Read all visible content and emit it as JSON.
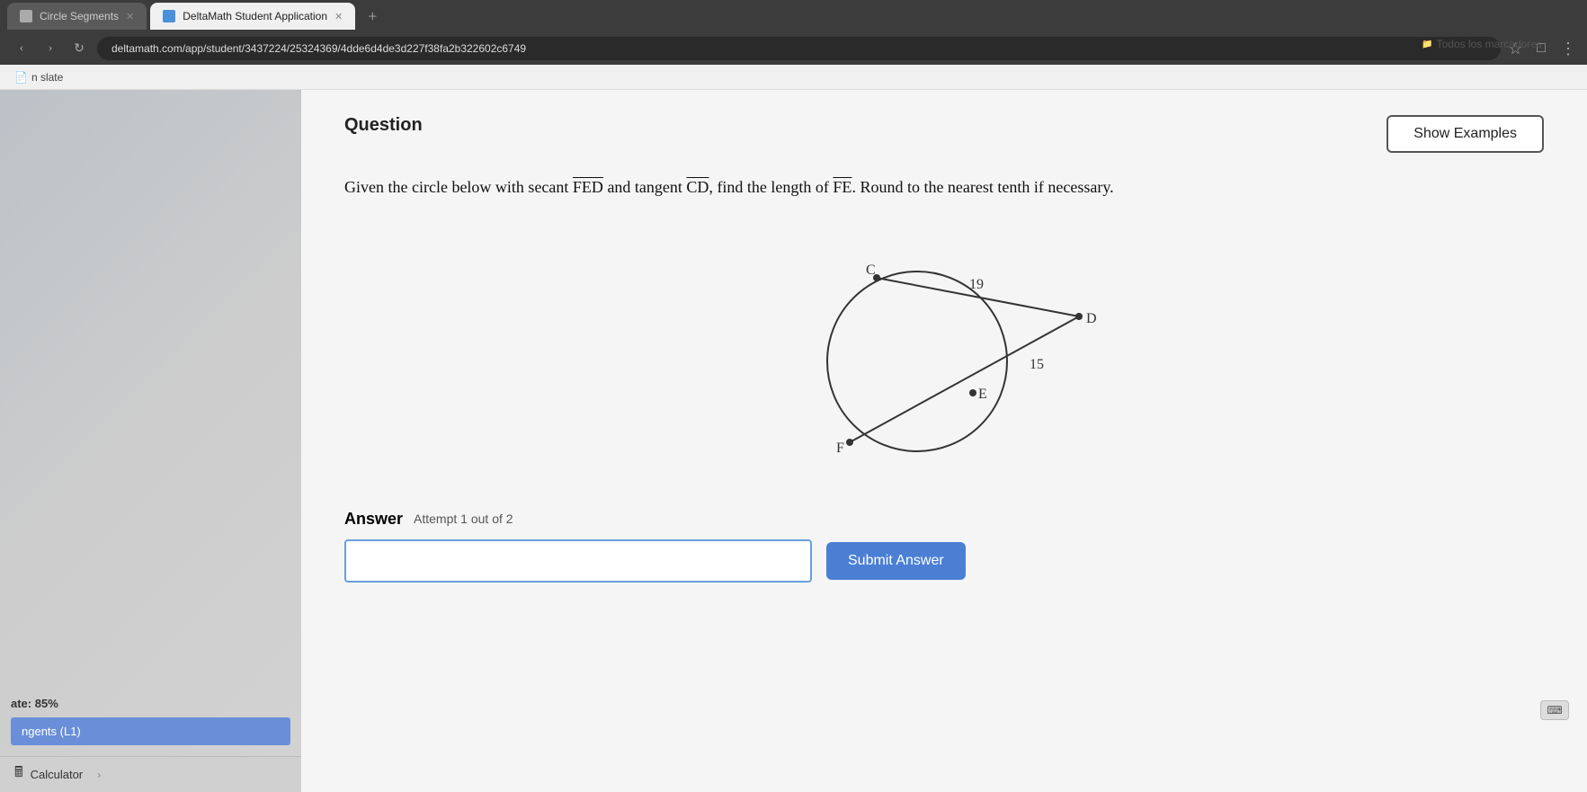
{
  "browser": {
    "tabs": [
      {
        "label": "Circle Segments",
        "active": false,
        "id": "tab1"
      },
      {
        "label": "DeltaMath Student Application",
        "active": true,
        "id": "tab2"
      }
    ],
    "url": "deltamath.com/app/student/3437224/25324369/4dde6d4de3d227f38fa2b322602c6749",
    "bookmark": "n slate",
    "todos_label": "Todos los marcadores",
    "new_tab_label": "+"
  },
  "win_controls": {
    "minimize": "—",
    "restore": "❐",
    "close": "✕"
  },
  "sidebar": {
    "score_label": "ate: 85%",
    "tangents_label": "ngents (L1)"
  },
  "question": {
    "section_label": "Question",
    "show_examples_label": "Show Examples",
    "text_part1": "Given the circle below with secant ",
    "secant_label": "FED",
    "text_part2": " and tangent ",
    "tangent_label": "CD",
    "text_part3": ", find the length of ",
    "find_label": "FE",
    "text_part4": ". Round to the nearest tenth if necessary.",
    "diagram": {
      "label_C": "C",
      "label_D": "D",
      "label_E": "E",
      "label_F": "F",
      "value_19": "19",
      "value_15": "15"
    }
  },
  "answer": {
    "label": "Answer",
    "attempt_label": "Attempt 1 out of 2",
    "input_placeholder": "",
    "submit_label": "Submit Answer"
  },
  "footer": {
    "calculator_label": "Calculator",
    "calc_icon": "🖩"
  }
}
